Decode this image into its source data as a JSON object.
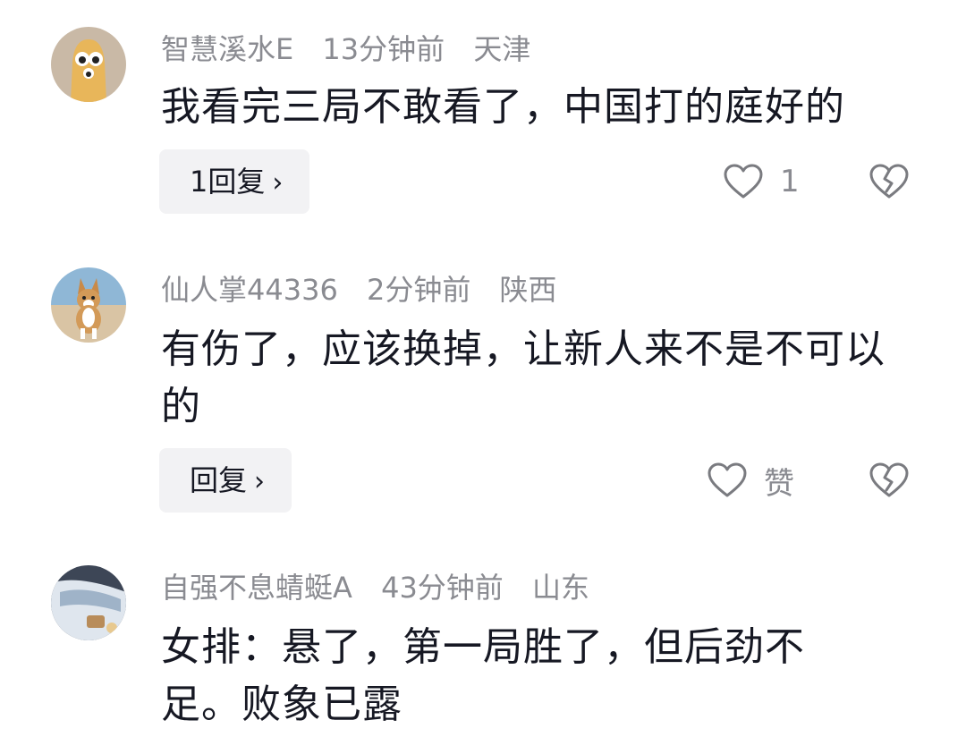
{
  "colors": {
    "meta": "#8a8b91",
    "text": "#161823",
    "reply_bg": "#f2f2f4",
    "icon_stroke": "#7a7b80"
  },
  "comments": [
    {
      "username": "智慧溪水E",
      "time": "13分钟前",
      "location": "天津",
      "text": "我看完三局不敢看了，中国打的庭好的",
      "reply_label": "1回复",
      "like_label": "1",
      "avatar_icon": "cartoon-character-avatar"
    },
    {
      "username": "仙人掌44336",
      "time": "2分钟前",
      "location": "陕西",
      "text": "有伤了，应该换掉，让新人来不是不可以的",
      "reply_label": "回复",
      "like_label": "赞",
      "avatar_icon": "corgi-dog-avatar"
    },
    {
      "username": "自强不息蜻蜓A",
      "time": "43分钟前",
      "location": "山东",
      "text": "女排：悬了，第一局胜了，但后劲不足。败象已露",
      "avatar_icon": "car-door-avatar"
    }
  ]
}
